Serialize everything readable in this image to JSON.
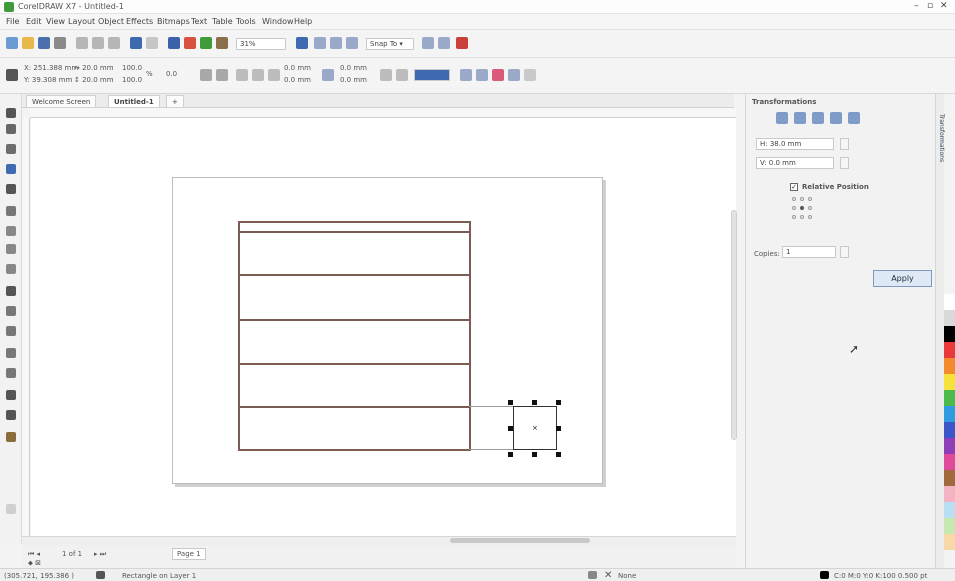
{
  "window": {
    "title": "CorelDRAW X7 - Untitled-1",
    "controls": [
      "–",
      "▫",
      "✕"
    ]
  },
  "menu": [
    "File",
    "Edit",
    "View",
    "Layout",
    "Object",
    "Effects",
    "Bitmaps",
    "Text",
    "Table",
    "Tools",
    "Window",
    "Help"
  ],
  "toolbar": {
    "zoom": "31%",
    "snap_to": "Snap To ▾"
  },
  "propbar": {
    "x": "X: 251.388 mm",
    "y": "Y: 39.308 mm",
    "w": "↔ 20.0 mm",
    "h": "↕ 20.0 mm",
    "scale_x": "100.0",
    "scale_y": "100.0",
    "pct": "%",
    "angle": "0.0",
    "corner1": "0.0 mm",
    "corner2": "0.0 mm",
    "corner3": "0.0 mm",
    "corner4": "0.0 mm"
  },
  "tabs": [
    "Welcome Screen",
    "Untitled-1",
    "+"
  ],
  "pagenav": {
    "page_count": "1 of 1",
    "page_tab": "Page 1"
  },
  "status": {
    "coords": "(305.721, 195.386 )",
    "layer": "Rectangle on Layer 1",
    "fill": "None",
    "color_info": "C:0 M:0 Y:0 K:100  0.500 pt"
  },
  "docker": {
    "title": "Transformations",
    "x_value": "H: 38.0 mm",
    "y_value": "V: 0.0 mm",
    "relative_label": "Relative Position",
    "copies_label": "Copies:",
    "copies_value": "1",
    "apply": "Apply"
  },
  "sidetab_label": "Transformations",
  "colors": {
    "line": "#7a5c52",
    "palette": [
      "#ffffff",
      "#d9d9d9",
      "#000000",
      "#e83a3a",
      "#f28b2e",
      "#f6e23a",
      "#4cbb4c",
      "#2f9be0",
      "#3a56c8",
      "#8e3fb8",
      "#e04a9b",
      "#a06a3d",
      "#f2b3c3",
      "#b8e0f2",
      "#c7e8b0",
      "#f7d9a8"
    ]
  }
}
